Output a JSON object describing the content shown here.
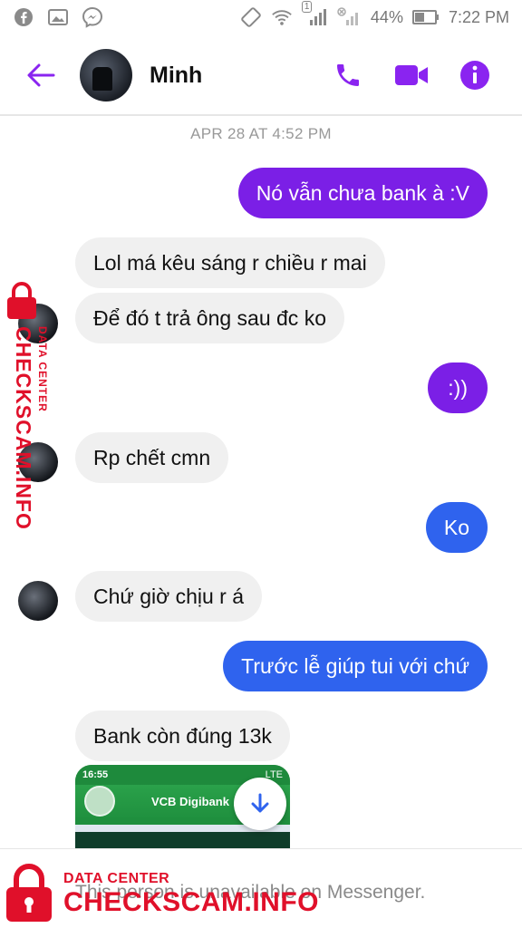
{
  "status_bar": {
    "battery": "44%",
    "time": "7:22 PM",
    "sim_badge": "1"
  },
  "header": {
    "contact_name": "Minh"
  },
  "chat": {
    "timestamp": "APR 28 AT 4:52 PM",
    "messages": [
      {
        "from": "me",
        "text": "Nó vẫn chưa bank à :V"
      },
      {
        "from": "them",
        "text": "Lol má kêu sáng r chiều r mai"
      },
      {
        "from": "them",
        "text": "Để đó t trả ông sau đc ko"
      },
      {
        "from": "me",
        "text": ":))"
      },
      {
        "from": "them",
        "text": "Rp chết cmn"
      },
      {
        "from": "me",
        "text": "Ko"
      },
      {
        "from": "them",
        "text": "Chứ giờ chịu r á"
      },
      {
        "from": "me",
        "text": "Trước lễ giúp tui với chứ"
      },
      {
        "from": "them",
        "text": "Bank còn đúng 13k"
      }
    ],
    "image_preview": {
      "time": "16:55",
      "signal": "LTE",
      "brand": "VCB Digibank"
    }
  },
  "footer": {
    "notice": "This person is unavailable on Messenger."
  },
  "watermark": {
    "small": "DATA CENTER",
    "big": "CHECKSCAM.INFO"
  },
  "colors": {
    "accent": "#8a24f0",
    "bubble_purple": "#7b1fe6",
    "bubble_blue": "#2f63ee",
    "bubble_gray": "#f0f0f0",
    "watermark_red": "#e0102a"
  }
}
